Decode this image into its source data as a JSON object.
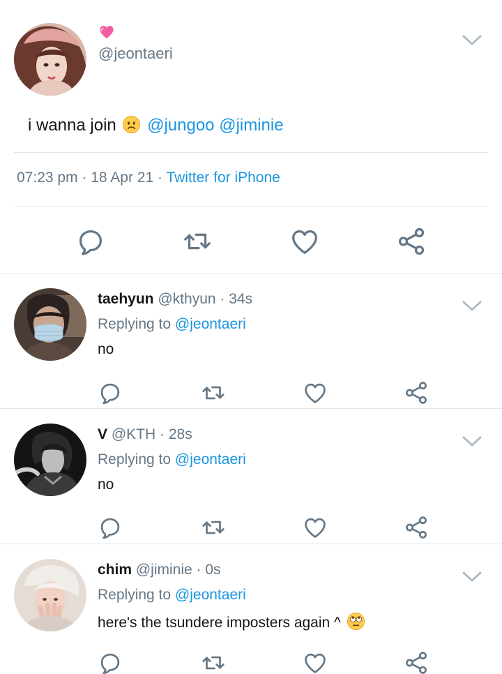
{
  "main_tweet": {
    "name_icon": "pink-heart-emoji",
    "handle": "@jeontaeri",
    "text_before": "i wanna join",
    "text_emoji": "frowning-face-emoji",
    "mention1": "@jungoo",
    "mention2": "@jiminie",
    "time": "07:23 pm",
    "date": "18 Apr 21",
    "source": "Twitter for iPhone",
    "actions": [
      "reply-icon",
      "retweet-icon",
      "like-icon",
      "share-icon"
    ]
  },
  "replies": [
    {
      "name": "taehyun",
      "handle": "@kthyun",
      "time": "34s",
      "replying_prefix": "Replying to",
      "replying_to": "@jeontaeri",
      "text": "no"
    },
    {
      "name": "V",
      "handle": "@KTH",
      "time": "28s",
      "replying_prefix": "Replying to",
      "replying_to": "@jeontaeri",
      "text": "no"
    },
    {
      "name": "chim",
      "handle": "@jiminie",
      "time": "0s",
      "replying_prefix": "Replying to",
      "replying_to": "@jeontaeri",
      "text": "here's the tsundere imposters again ^",
      "text_emoji": "eye-roll-emoji"
    }
  ],
  "colors": {
    "link": "#1b95e0",
    "secondary": "#657786",
    "icon": "#657786",
    "divider": "#e1e8ed"
  }
}
